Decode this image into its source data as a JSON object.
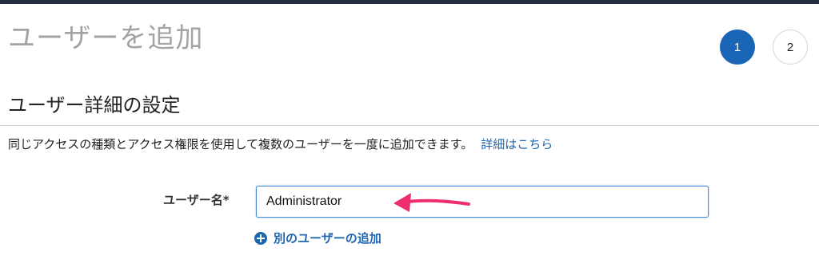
{
  "header": {
    "page_title": "ユーザーを追加"
  },
  "steps": [
    {
      "label": "1",
      "active": true
    },
    {
      "label": "2",
      "active": false
    }
  ],
  "section": {
    "title": "ユーザー詳細の設定",
    "description": "同じアクセスの種類とアクセス権限を使用して複数のユーザーを一度に追加できます。",
    "details_link": "詳細はこちら"
  },
  "form": {
    "username_label": "ユーザー名*",
    "username_value": "Administrator",
    "add_user_link": "別のユーザーの追加"
  },
  "colors": {
    "accent": "#1a65b5",
    "link": "#1e66b0",
    "annotation_arrow": "#ee2d6c",
    "topbar": "#232f3e"
  },
  "icons": {
    "add": "plus-circle-icon",
    "annotation": "arrow-left-icon"
  }
}
